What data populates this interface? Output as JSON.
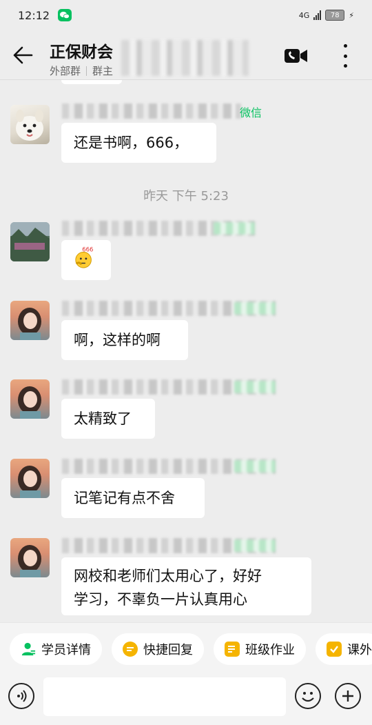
{
  "status_bar": {
    "time": "12:12",
    "network": "4G",
    "battery": "78"
  },
  "header": {
    "title": "正保财会",
    "subtitle_external": "外部群",
    "subtitle_owner": "群主"
  },
  "chat": {
    "time_divider": "昨天  下午 5:23",
    "messages": [
      {
        "sender_tag": "微信",
        "text": "还是书啊，666，"
      },
      {
        "sender_tag": "",
        "text": ""
      },
      {
        "sender_tag": "",
        "text": "啊，这样的啊"
      },
      {
        "sender_tag": "",
        "text": "太精致了"
      },
      {
        "sender_tag": "",
        "text": "记笔记有点不舍"
      },
      {
        "sender_tag": "",
        "text_line1": "网校和老师们太用心了，好好",
        "text_line2": "学习，不辜负一片认真用心"
      }
    ],
    "sticker_text": "666"
  },
  "quick_actions": [
    {
      "label": "学员详情",
      "icon": "student-icon",
      "color": "#07c160"
    },
    {
      "label": "快捷回复",
      "icon": "quick-reply-icon",
      "color": "#f5b400"
    },
    {
      "label": "班级作业",
      "icon": "homework-icon",
      "color": "#f5b400"
    },
    {
      "label": "课外",
      "icon": "calendar-icon",
      "color": "#f5b400"
    }
  ],
  "input": {
    "placeholder": ""
  }
}
